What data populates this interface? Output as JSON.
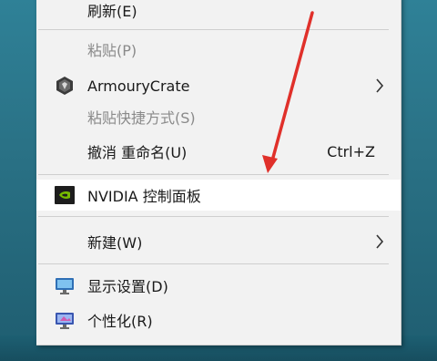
{
  "menu": {
    "refresh": "刷新(E)",
    "paste": "粘贴(P)",
    "armoury": "ArmouryCrate",
    "paste_shortcut": "粘贴快捷方式(S)",
    "undo": "撤消 重命名(U)",
    "undo_shortcut": "Ctrl+Z",
    "nvidia": "NVIDIA 控制面板",
    "new": "新建(W)",
    "display": "显示设置(D)",
    "personalize": "个性化(R)"
  },
  "icons": {
    "armoury": "armoury-crate-icon",
    "nvidia": "nvidia-icon",
    "display": "display-monitor-icon",
    "personalize": "personalize-monitor-icon",
    "submenu": "chevron-right-icon"
  },
  "colors": {
    "menu_bg": "#f2f2f2",
    "highlight_bg": "#ffffff",
    "disabled_text": "#8a8a8a",
    "annotation_arrow": "#e0302a",
    "desktop": "#2a7286"
  }
}
